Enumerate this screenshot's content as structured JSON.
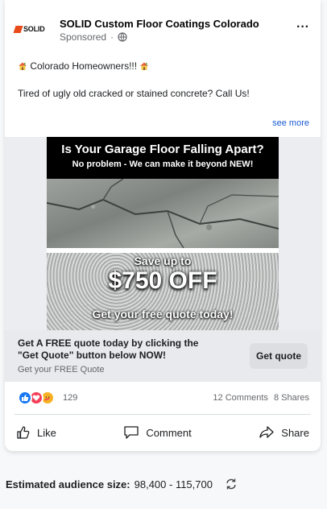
{
  "post": {
    "page_name": "SOLID Custom Floor Coatings Colorado",
    "logo_text": "SOLID",
    "sponsored": "Sponsored",
    "separator": "·",
    "more_menu": "···",
    "text_line1": "Colorado Homeowners!!!",
    "text_line2": "Tired of ugly old cracked or stained concrete? Call Us!",
    "see_more": "see more"
  },
  "ad_image": {
    "title": "Is Your Garage Floor Falling Apart?",
    "subtitle": "No problem - We can make it beyond NEW!",
    "save_text": "Save up to",
    "amount_text": "$750 OFF",
    "quote_text": "Get your free quote today!"
  },
  "cta": {
    "headline": "Get A FREE quote today by clicking the \"Get Quote\" button below NOW!",
    "subline": "Get your FREE Quote",
    "button_label": "Get quote"
  },
  "engagement": {
    "reaction_count": "129",
    "comments": "12 Comments",
    "shares": "8 Shares"
  },
  "actions": {
    "like": "Like",
    "comment": "Comment",
    "share": "Share"
  },
  "audience": {
    "label": "Estimated audience size:",
    "value": "98,400 - 115,700"
  },
  "icons": {
    "house": "house-emoji-icon",
    "globe": "globe-icon",
    "like_reaction": "like-reaction-icon",
    "love_reaction": "love-reaction-icon",
    "care_reaction": "care-reaction-icon",
    "refresh": "refresh-icon"
  },
  "colors": {
    "link": "#1a5bd4",
    "logo_accent": "#e84b1a",
    "like_blue": "#1877f2",
    "love_red": "#f33e58",
    "care_yellow": "#f7b125"
  }
}
